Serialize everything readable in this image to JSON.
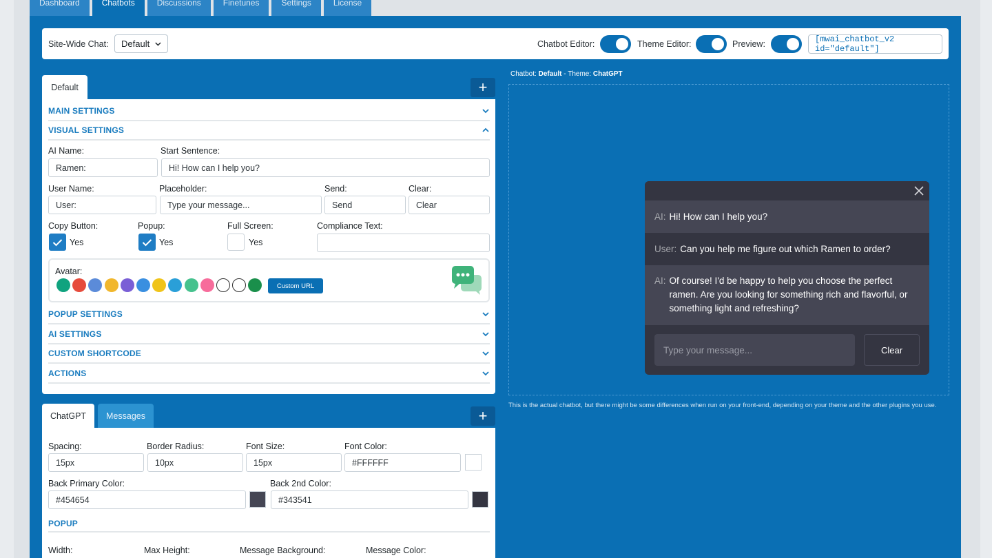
{
  "nav": {
    "tabs": [
      {
        "label": "Dashboard",
        "active": false
      },
      {
        "label": "Chatbots",
        "active": true
      },
      {
        "label": "Discussions",
        "active": false
      },
      {
        "label": "Finetunes",
        "active": false
      },
      {
        "label": "Settings",
        "active": false
      },
      {
        "label": "License",
        "active": false
      }
    ]
  },
  "topbar": {
    "sitewide_label": "Site-Wide Chat:",
    "sitewide_value": "Default",
    "chatbot_editor_label": "Chatbot Editor:",
    "chatbot_editor_on": true,
    "theme_editor_label": "Theme Editor:",
    "theme_editor_on": true,
    "preview_label": "Preview:",
    "preview_on": true,
    "shortcode": "[mwai_chatbot_v2 id=\"default\"]"
  },
  "chatbot_panel": {
    "tab": "Default",
    "add": "+",
    "sections": {
      "main": "MAIN SETTINGS",
      "visual": "VISUAL SETTINGS",
      "popup": "POPUP SETTINGS",
      "ai": "AI SETTINGS",
      "shortcode": "CUSTOM SHORTCODE",
      "actions": "ACTIONS"
    },
    "fields": {
      "ai_name_label": "AI Name:",
      "ai_name": "Ramen:",
      "start_sentence_label": "Start Sentence:",
      "start_sentence": "Hi! How can I help you?",
      "user_name_label": "User Name:",
      "user_name": "User:",
      "placeholder_label": "Placeholder:",
      "placeholder": "Type your message...",
      "send_label": "Send:",
      "send": "Send",
      "clear_label": "Clear:",
      "clear": "Clear",
      "copy_button_label": "Copy Button:",
      "copy_button_checked": true,
      "popup_label": "Popup:",
      "popup_checked": true,
      "full_screen_label": "Full Screen:",
      "full_screen_checked": false,
      "yes": "Yes",
      "compliance_label": "Compliance Text:",
      "compliance": ""
    },
    "avatar": {
      "label": "Avatar:",
      "custom_url": "Custom URL",
      "icons": [
        "openai-icon",
        "robot-red-icon",
        "robot-arm-icon",
        "robot-yellow-icon",
        "robot-purple-icon",
        "robot-blue-icon",
        "robot-round-icon",
        "chat-bubbles-icon",
        "chat-green-icon",
        "heart-chat-icon",
        "chat-outline-icon",
        "chat-double-icon",
        "chat-dark-green-icon"
      ],
      "colors": [
        "#10a37f",
        "#e64b3c",
        "#5b8bd9",
        "#f1b72d",
        "#7a5fd6",
        "#3a8fe0",
        "#f0c419",
        "#2a9fd8",
        "#46c28e",
        "#f76c9b",
        "#ffffff",
        "#ffffff",
        "#1a8f4b"
      ]
    }
  },
  "theme_panel": {
    "tabs": [
      "ChatGPT",
      "Messages"
    ],
    "add": "+",
    "spacing_label": "Spacing:",
    "spacing": "15px",
    "border_radius_label": "Border Radius:",
    "border_radius": "10px",
    "font_size_label": "Font Size:",
    "font_size": "15px",
    "font_color_label": "Font Color:",
    "font_color": "#FFFFFF",
    "back_primary_label": "Back Primary Color:",
    "back_primary": "#454654",
    "back_2nd_label": "Back 2nd Color:",
    "back_2nd": "#343541",
    "popup_heading": "POPUP",
    "width_label": "Width:",
    "max_height_label": "Max Height:",
    "message_background_label": "Message Background:",
    "message_color_label": "Message Color:"
  },
  "preview": {
    "info_prefix": "Chatbot: ",
    "info_bot": "Default",
    "info_mid": " - Theme: ",
    "info_theme": "ChatGPT",
    "messages": [
      {
        "who": "AI:",
        "text": "Hi! How can I help you?",
        "role": "ai"
      },
      {
        "who": "User:",
        "text": "Can you help me figure out which Ramen to order?",
        "role": "user"
      },
      {
        "who": "AI:",
        "text": "Of course! I'd be happy to help you choose the perfect ramen. Are you looking for something rich and flavorful, or something light and refreshing?",
        "role": "ai"
      }
    ],
    "input_placeholder": "Type your message...",
    "clear": "Clear",
    "disclaimer": "This is the actual chatbot, but there might be some differences when run on your front-end, depending on your theme and the other plugins you use."
  }
}
